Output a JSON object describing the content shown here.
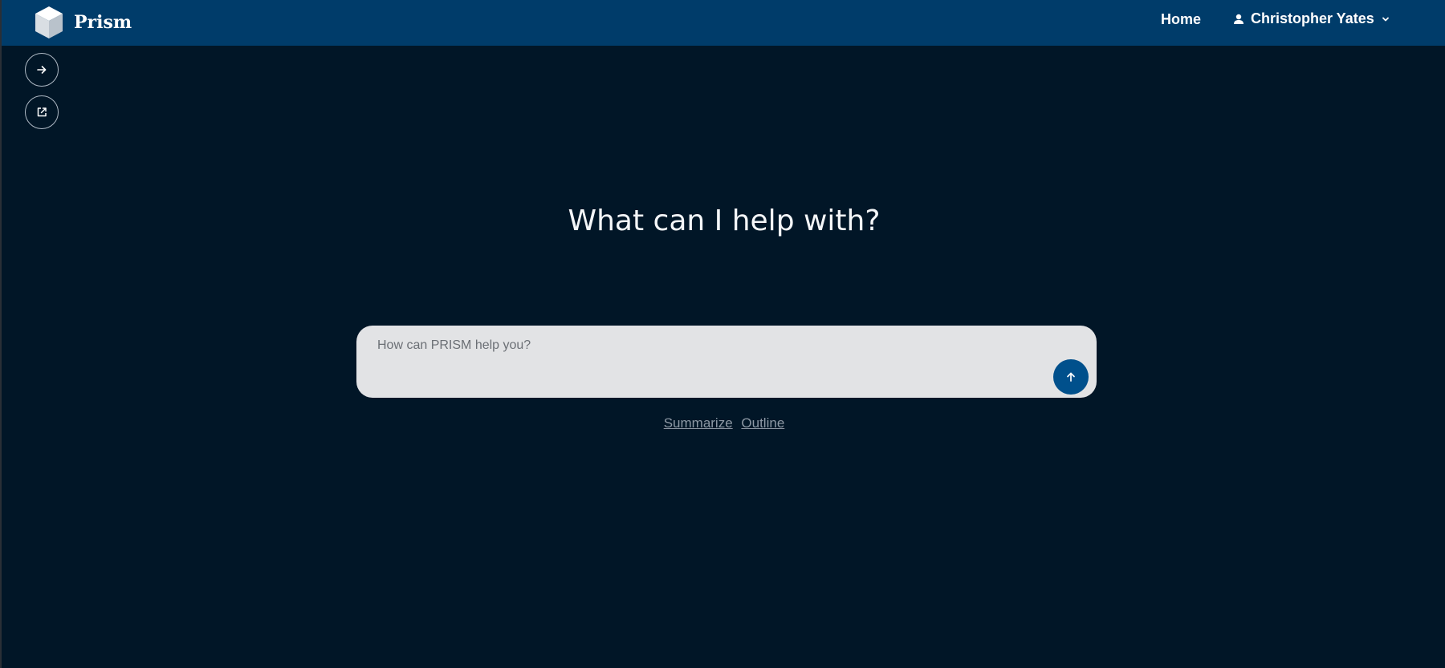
{
  "header": {
    "brand": "Prism",
    "nav_home": "Home",
    "user_name": "Christopher Yates",
    "logo_icon": "cube-icon",
    "user_icon": "person-icon",
    "dropdown_icon": "chevron-down-icon"
  },
  "sidebar": {
    "buttons": [
      {
        "icon": "arrow-right-icon"
      },
      {
        "icon": "open-external-icon"
      }
    ]
  },
  "main": {
    "headline": "What can I help with?",
    "input": {
      "placeholder": "How can PRISM help you?",
      "value": ""
    },
    "send_icon": "arrow-up-icon",
    "suggestions": [
      "Summarize",
      "Outline"
    ]
  },
  "colors": {
    "background": "#011627",
    "topbar": "#003c6a",
    "accent": "#00508c",
    "input_bg": "#e2e3e5"
  }
}
